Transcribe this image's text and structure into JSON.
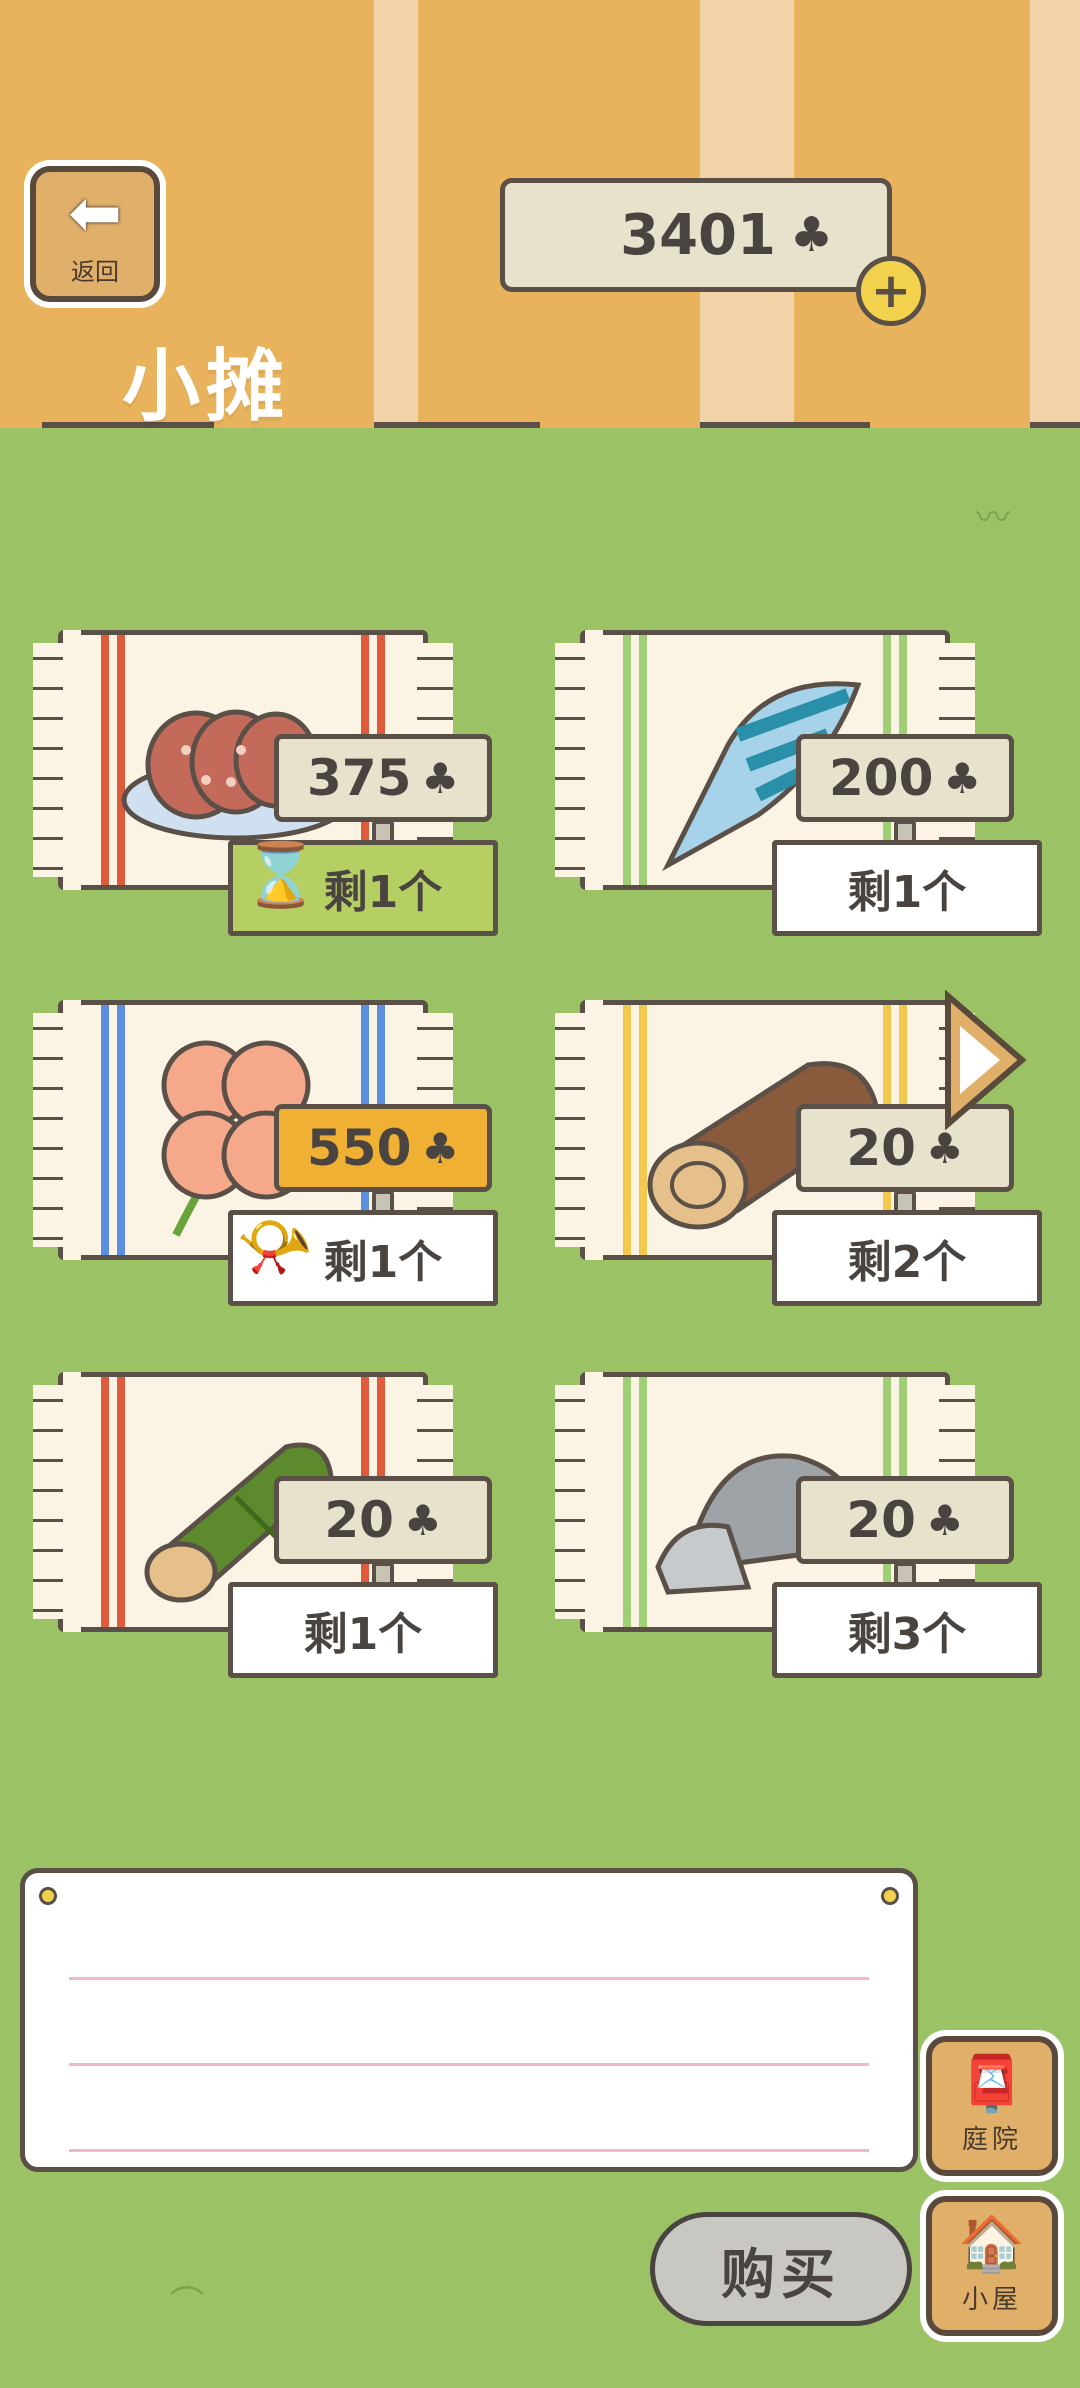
{
  "header": {
    "back_label": "返回",
    "title": "小摊",
    "clover_count": "3401",
    "currency_icon": "clover-icon"
  },
  "items": [
    {
      "price": "375",
      "stock": "剩1个",
      "picture": "sausage-slices",
      "mat_stripe": "#e05a3c",
      "price_style": "normal",
      "stock_style": "green-timed"
    },
    {
      "price": "200",
      "stock": "剩1个",
      "picture": "seashell",
      "mat_stripe": "#9fcf74",
      "price_style": "normal",
      "stock_style": "normal"
    },
    {
      "price": "550",
      "stock": "剩1个",
      "picture": "four-leaf-clover",
      "mat_stripe": "#5b8fe0",
      "price_style": "gold",
      "stock_style": "horn"
    },
    {
      "price": "20",
      "stock": "剩2个",
      "picture": "wood-log",
      "mat_stripe": "#f2c94c",
      "price_style": "normal",
      "stock_style": "normal"
    },
    {
      "price": "20",
      "stock": "剩1个",
      "picture": "bamboo",
      "mat_stripe": "#e05a3c",
      "price_style": "normal",
      "stock_style": "normal"
    },
    {
      "price": "20",
      "stock": "剩3个",
      "picture": "stones",
      "mat_stripe": "#9fcf74",
      "price_style": "normal",
      "stock_style": "normal"
    }
  ],
  "nav": {
    "yard_label": "庭院",
    "house_label": "小屋",
    "buy_label": "购买"
  },
  "colors": {
    "grass": "#9bc265",
    "stripe_light": "#f3d3a8",
    "stripe_dark": "#e8b35c",
    "outline": "#5a5048"
  }
}
